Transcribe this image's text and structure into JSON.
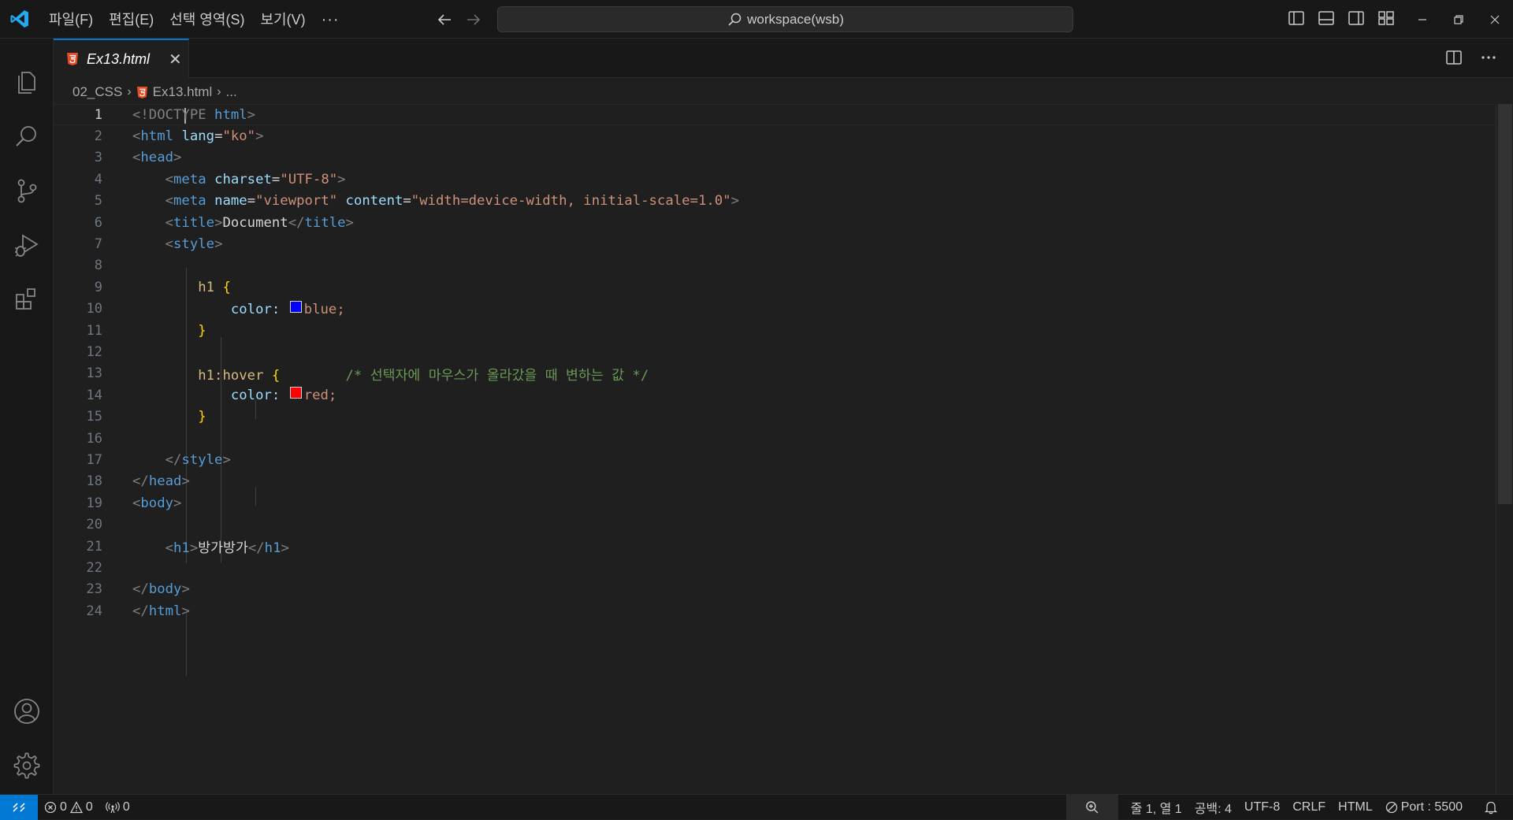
{
  "menu": {
    "file": "파일(F)",
    "edit": "편집(E)",
    "selection": "선택 영역(S)",
    "view": "보기(V)",
    "more": "···"
  },
  "command_center": {
    "text": "workspace(wsb)"
  },
  "tab": {
    "label": "Ex13.html",
    "close": "✕"
  },
  "breadcrumb": {
    "folder": "02_CSS",
    "file": "Ex13.html",
    "more": "..."
  },
  "line_numbers": [
    "1",
    "2",
    "3",
    "4",
    "5",
    "6",
    "7",
    "8",
    "9",
    "10",
    "11",
    "12",
    "13",
    "14",
    "15",
    "16",
    "17",
    "18",
    "19",
    "20",
    "21",
    "22",
    "23",
    "24"
  ],
  "code": {
    "doctype": "!DOCTYPE",
    "html": "html",
    "head": "head",
    "meta": "meta",
    "title": "title",
    "style": "style",
    "body": "body",
    "h1": "h1",
    "lang_attr": "lang",
    "lang_val": "\"ko\"",
    "charset_attr": "charset",
    "charset_val": "\"UTF-8\"",
    "name_attr": "name",
    "name_val": "\"viewport\"",
    "content_attr": "content",
    "content_val": "\"width=device-width, initial-scale=1.0\"",
    "title_text": "Document",
    "sel_h1": "h1",
    "sel_h1_hover": "h1:hover",
    "prop_color": "color:",
    "val_blue": "blue;",
    "val_red": "red;",
    "comment": "/* 선택자에 마우스가 올라갔을 때 변하는 값 */",
    "h1_text": "방가방가",
    "swatch_blue": "#0000ff",
    "swatch_red": "#ff0000"
  },
  "status": {
    "errors": "0",
    "warnings": "0",
    "ports": "0",
    "position": "줄 1, 열 1",
    "spaces": "공백: 4",
    "encoding": "UTF-8",
    "eol": "CRLF",
    "language": "HTML",
    "port": "Port : 5500"
  },
  "colors": {
    "accent": "#0078d4",
    "background": "#1f1f1f",
    "sidebar": "#181818"
  }
}
